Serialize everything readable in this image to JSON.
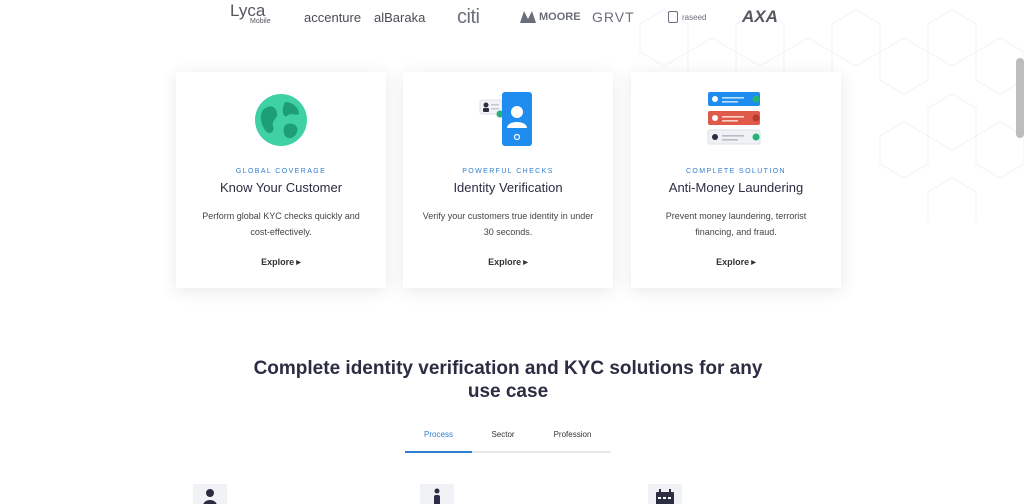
{
  "logos": {
    "lyca": "Lyca",
    "lyca_sub": "Mobile",
    "accenture": "accenture",
    "albaraka": "alBaraka",
    "citi": "citi",
    "moore": "MOORE",
    "grvt": "GRVT",
    "raseed": "raseed",
    "axa": "AXA"
  },
  "cards": [
    {
      "eyebrow": "GLOBAL COVERAGE",
      "title": "Know Your Customer",
      "description": "Perform global KYC checks quickly and cost-effectively.",
      "link": "Explore",
      "icon": "globe-icon"
    },
    {
      "eyebrow": "POWERFUL CHECKS",
      "title": "Identity Verification",
      "description": "Verify your customers true identity in under 30 seconds.",
      "link": "Explore",
      "icon": "phone-id-icon"
    },
    {
      "eyebrow": "COMPLETE SOLUTION",
      "title": "Anti-Money Laundering",
      "description": "Prevent money laundering, terrorist financing, and fraud.",
      "link": "Explore",
      "icon": "id-list-icon"
    }
  ],
  "section": {
    "headline": "Complete identity verification and KYC solutions for any use case"
  },
  "tabs": {
    "process": "Process",
    "sector": "Sector",
    "profession": "Profession",
    "active": "Process"
  },
  "colors": {
    "accent": "#2f7dd1",
    "heading": "#2b2d42",
    "globe": "#3fd0a3",
    "phone": "#1f8cf0",
    "alert": "#e05a4a"
  }
}
